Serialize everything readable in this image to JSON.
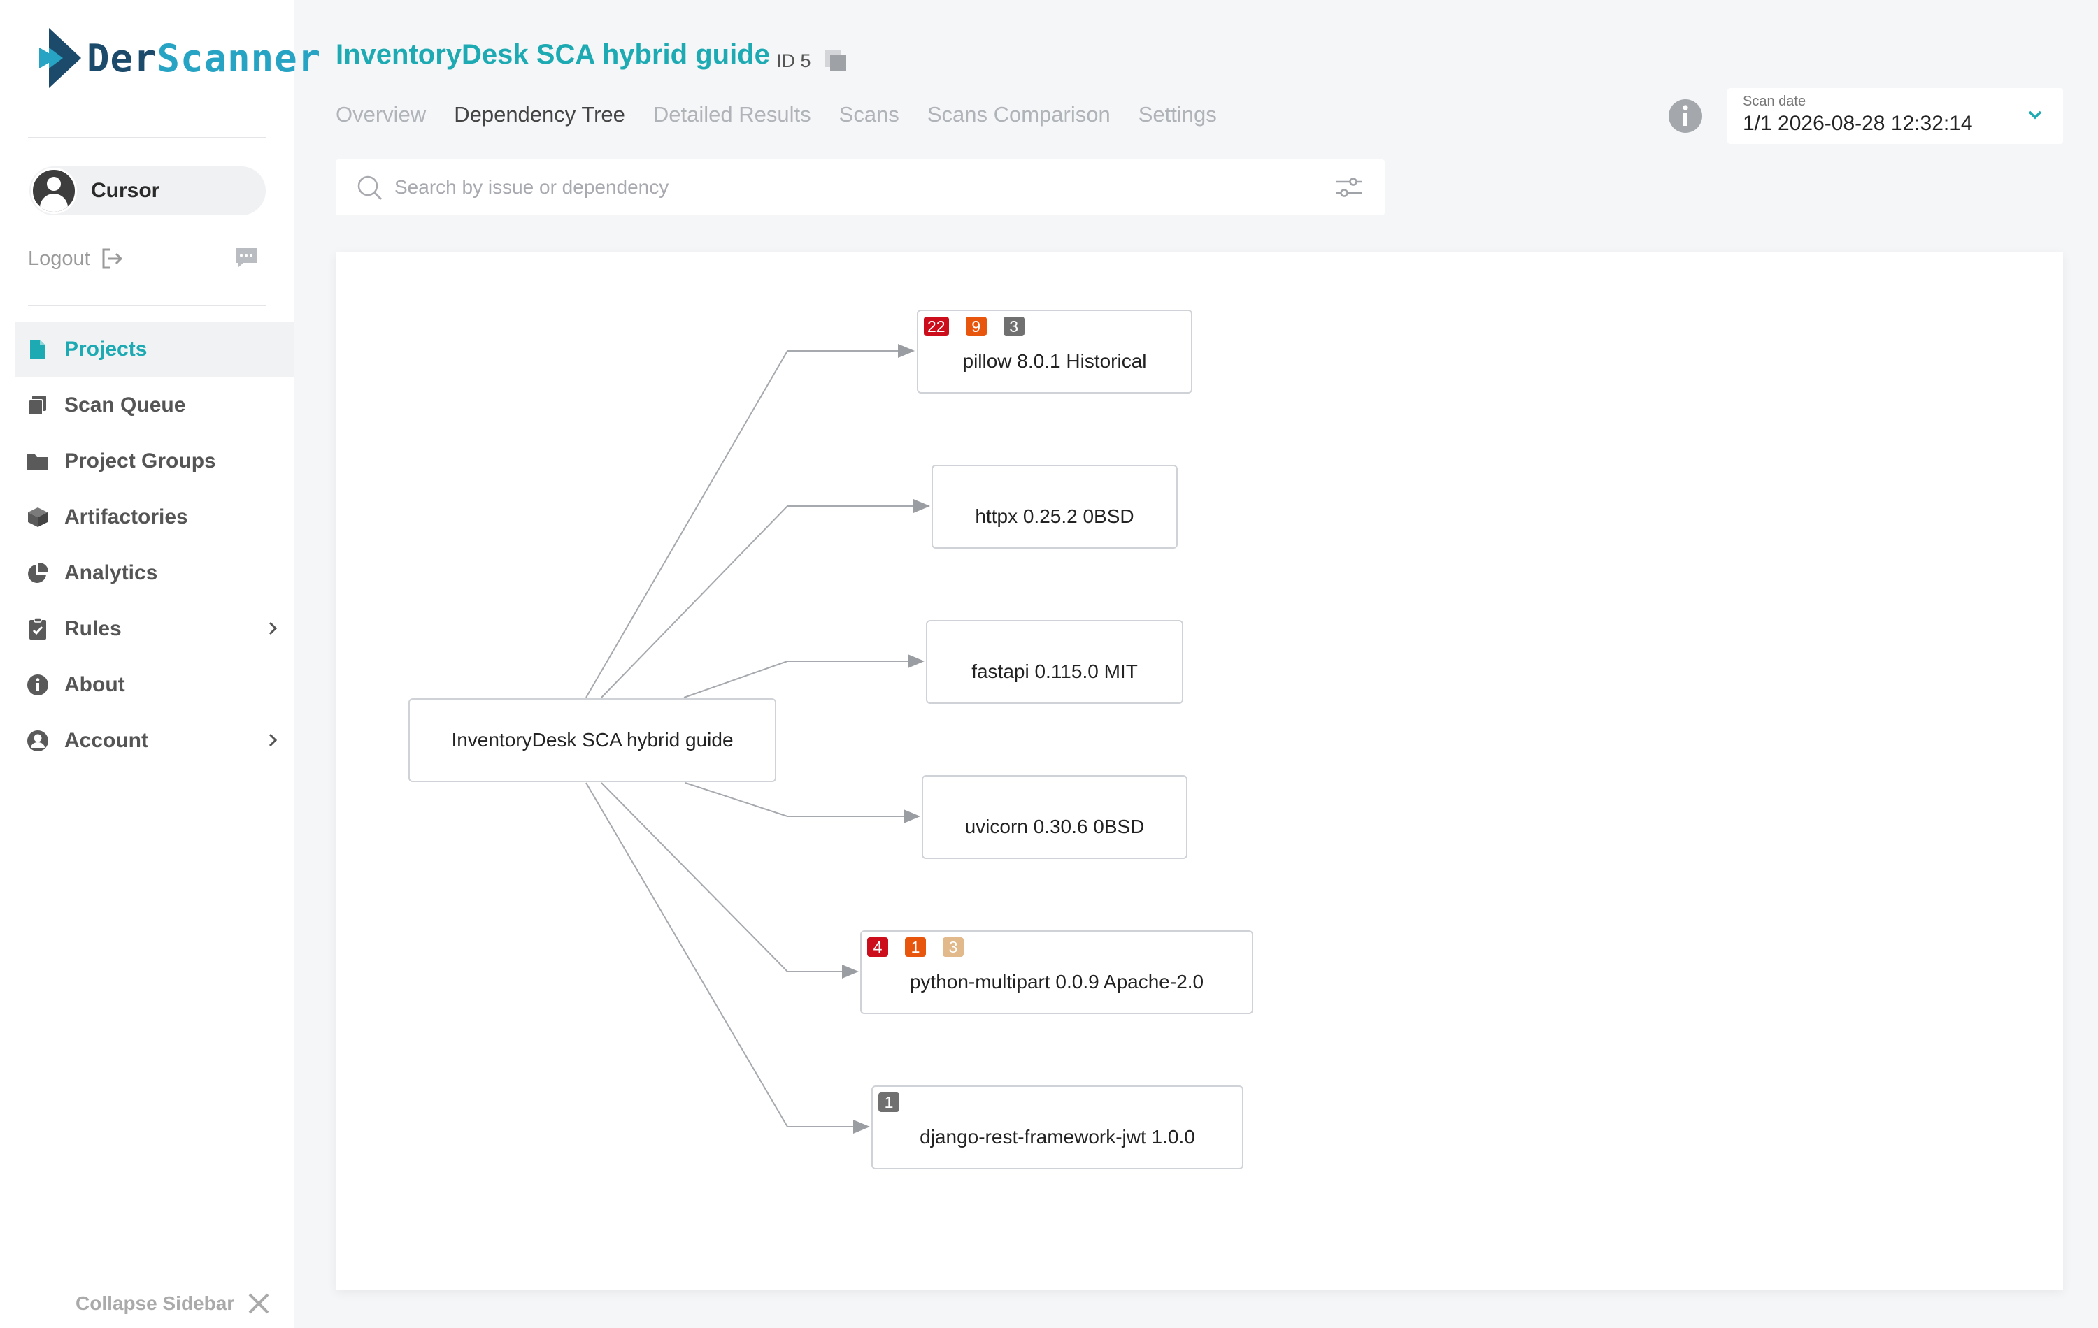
{
  "brand": {
    "name_part1": "Der",
    "name_part2": "Scanner"
  },
  "user": {
    "name": "Cursor",
    "logout_label": "Logout"
  },
  "nav": {
    "items": [
      {
        "label": "Projects",
        "icon": "file-icon",
        "active": true
      },
      {
        "label": "Scan Queue",
        "icon": "queue-icon"
      },
      {
        "label": "Project Groups",
        "icon": "folder-icon"
      },
      {
        "label": "Artifactories",
        "icon": "box-icon"
      },
      {
        "label": "Analytics",
        "icon": "pie-chart-icon"
      },
      {
        "label": "Rules",
        "icon": "clipboard-check-icon",
        "has_submenu": true
      },
      {
        "label": "About",
        "icon": "info-icon"
      },
      {
        "label": "Account",
        "icon": "user-icon",
        "has_submenu": true
      }
    ]
  },
  "collapse_label": "Collapse Sidebar",
  "project": {
    "title": "InventoryDesk SCA hybrid guide",
    "id_label": "ID 5"
  },
  "tabs": [
    {
      "label": "Overview"
    },
    {
      "label": "Dependency Tree",
      "active": true
    },
    {
      "label": "Detailed Results"
    },
    {
      "label": "Scans"
    },
    {
      "label": "Scans Comparison"
    },
    {
      "label": "Settings"
    }
  ],
  "scan_date": {
    "label": "Scan date",
    "value": "1/1 2026-08-28 12:32:14"
  },
  "search": {
    "placeholder": "Search by issue or dependency",
    "value": ""
  },
  "tree": {
    "root": {
      "label": "InventoryDesk SCA hybrid guide"
    },
    "children": [
      {
        "label": "pillow 8.0.1 Historical",
        "badges": [
          {
            "count": "22",
            "severity": "critical"
          },
          {
            "count": "9",
            "severity": "high"
          },
          {
            "count": "3",
            "severity": "info"
          }
        ]
      },
      {
        "label": "httpx 0.25.2 0BSD",
        "badges": []
      },
      {
        "label": "fastapi 0.115.0 MIT",
        "badges": []
      },
      {
        "label": "uvicorn 0.30.6 0BSD",
        "badges": []
      },
      {
        "label": "python-multipart 0.0.9 Apache-2.0",
        "badges": [
          {
            "count": "4",
            "severity": "critical"
          },
          {
            "count": "1",
            "severity": "high"
          },
          {
            "count": "3",
            "severity": "low"
          }
        ]
      },
      {
        "label": "django-rest-framework-jwt 1.0.0",
        "badges": [
          {
            "count": "1",
            "severity": "info"
          }
        ]
      }
    ]
  },
  "colors": {
    "accent": "#1eaab3",
    "critical": "#cc0d1b",
    "high": "#e8560e",
    "low": "#e2b98a",
    "info": "#707070"
  }
}
